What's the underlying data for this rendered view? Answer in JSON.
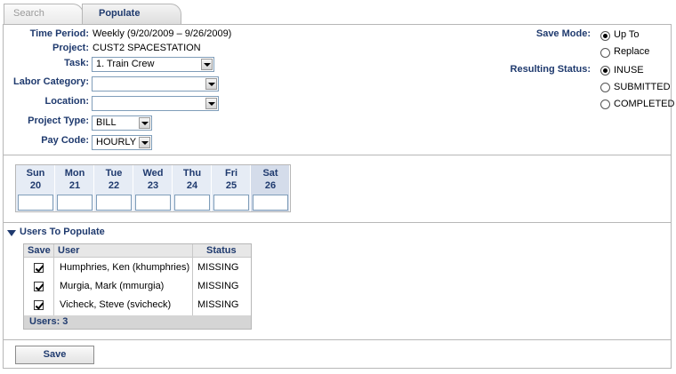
{
  "tabs": {
    "search": "Search",
    "populate": "Populate"
  },
  "form": {
    "time_period_label": "Time Period:",
    "time_period_value": "Weekly (9/20/2009 – 9/26/2009)",
    "project_label": "Project:",
    "project_value": "CUST2 SPACESTATION",
    "task_label": "Task:",
    "task_value": "1. Train Crew",
    "labor_category_label": "Labor Category:",
    "labor_category_value": "",
    "location_label": "Location:",
    "location_value": "",
    "project_type_label": "Project Type:",
    "project_type_value": "BILL",
    "pay_code_label": "Pay Code:",
    "pay_code_value": "HOURLY"
  },
  "save_mode": {
    "label": "Save Mode:",
    "options": [
      "Up To",
      "Replace"
    ],
    "selected": "Up To"
  },
  "resulting_status": {
    "label": "Resulting Status:",
    "options": [
      "INUSE",
      "SUBMITTED",
      "COMPLETED"
    ],
    "selected": "INUSE"
  },
  "days": [
    {
      "name": "Sun",
      "num": "20",
      "value": ""
    },
    {
      "name": "Mon",
      "num": "21",
      "value": ""
    },
    {
      "name": "Tue",
      "num": "22",
      "value": ""
    },
    {
      "name": "Wed",
      "num": "23",
      "value": ""
    },
    {
      "name": "Thu",
      "num": "24",
      "value": ""
    },
    {
      "name": "Fri",
      "num": "25",
      "value": ""
    },
    {
      "name": "Sat",
      "num": "26",
      "value": ""
    }
  ],
  "users_section": {
    "title": "Users To Populate",
    "headers": {
      "save": "Save",
      "user": "User",
      "status": "Status"
    },
    "rows": [
      {
        "user": "Humphries, Ken (khumphries)",
        "status": "MISSING",
        "checked": true
      },
      {
        "user": "Murgia, Mark (mmurgia)",
        "status": "MISSING",
        "checked": true
      },
      {
        "user": "Vicheck, Steve (svicheck)",
        "status": "MISSING",
        "checked": true
      }
    ],
    "footer": "Users: 3"
  },
  "save_button": "Save",
  "colors": {
    "label_blue": "#1f3a6e",
    "day_header": "#e6ecf5",
    "weekend_header": "#d4dcea",
    "border": "#b7b7b7"
  }
}
